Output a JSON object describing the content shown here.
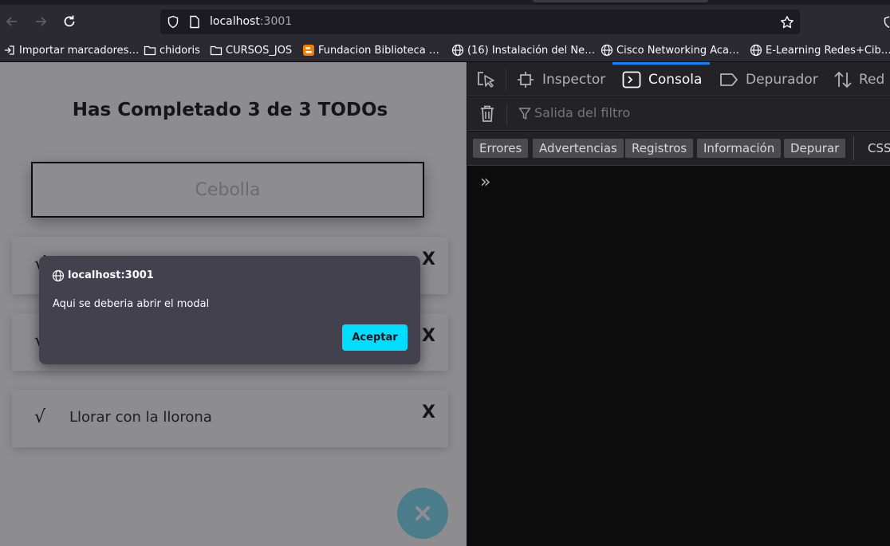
{
  "browser": {
    "url_host": "localhost",
    "url_port": ":3001",
    "bookmarks": [
      {
        "label": "Importar marcadores…",
        "icon": "import-icon"
      },
      {
        "label": "chidoris",
        "icon": "folder-icon"
      },
      {
        "label": "CURSOS_JOS",
        "icon": "folder-icon"
      },
      {
        "label": "Fundacion Biblioteca …",
        "icon": "blogger-icon"
      },
      {
        "label": "(16) Instalación del Ne…",
        "icon": "globe-icon"
      },
      {
        "label": "Cisco Networking Aca…",
        "icon": "globe-icon"
      },
      {
        "label": "E-Learning Redes+Cib…",
        "icon": "globe-icon"
      }
    ]
  },
  "page": {
    "title": "Has Completado 3 de 3 TODOs",
    "input_placeholder": "Cebolla",
    "todos": [
      {
        "check": "√",
        "text": "",
        "delete": "X"
      },
      {
        "check": "√",
        "text": "",
        "delete": "X"
      },
      {
        "check": "√",
        "text": "Llorar con la llorona",
        "delete": "X"
      }
    ],
    "fab_icon": "close-icon"
  },
  "modal": {
    "host": "localhost:3001",
    "message": "Aqui se deberia abrir el modal",
    "accept_label": "Aceptar"
  },
  "devtools": {
    "tabs": [
      "Inspector",
      "Consola",
      "Depurador",
      "Red"
    ],
    "active_tab": "Consola",
    "filter_placeholder": "Salida del filtro",
    "levels": [
      "Errores",
      "Advertencias",
      "Registros",
      "Información",
      "Depurar"
    ],
    "css_label": "CSS",
    "prompt": "»"
  },
  "colors": {
    "accent": "#00ddff",
    "fab": "#78dcf2",
    "devtools_tab_highlight": "#0a84ff"
  }
}
